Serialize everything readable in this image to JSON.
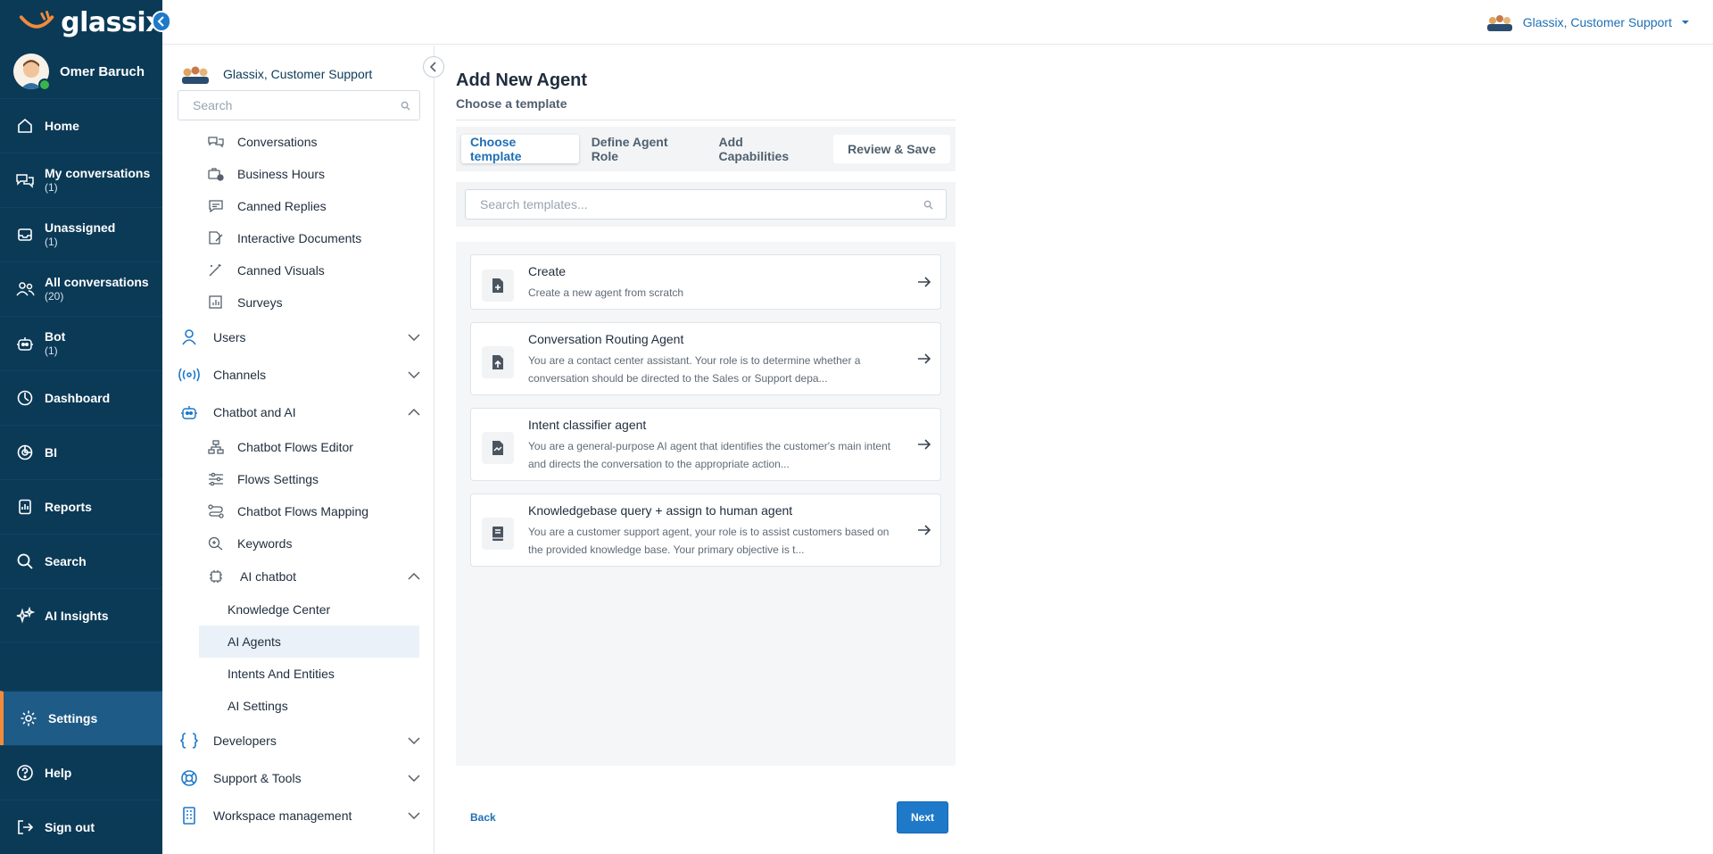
{
  "app": {
    "logo_text": "glassix"
  },
  "user": {
    "name": "Omer Baruch"
  },
  "nav": [
    {
      "label": "Home",
      "count": "",
      "icon": "home-icon"
    },
    {
      "label": "My conversations",
      "count": "(1)",
      "icon": "chat-bubbles-icon"
    },
    {
      "label": "Unassigned",
      "count": "(1)",
      "icon": "inbox-icon"
    },
    {
      "label": "All conversations",
      "count": "(20)",
      "icon": "people-icon"
    },
    {
      "label": "Bot",
      "count": "(1)",
      "icon": "bot-icon"
    },
    {
      "label": "Dashboard",
      "count": "",
      "icon": "dashboard-icon"
    },
    {
      "label": "BI",
      "count": "",
      "icon": "pie-chart-icon"
    },
    {
      "label": "Reports",
      "count": "",
      "icon": "reports-icon"
    },
    {
      "label": "Search",
      "count": "",
      "icon": "search-icon"
    },
    {
      "label": "AI Insights",
      "count": "",
      "icon": "sparkle-icon"
    }
  ],
  "nav_bottom": [
    {
      "label": "Settings",
      "icon": "gear-icon",
      "active": true
    },
    {
      "label": "Help",
      "icon": "help-icon",
      "active": false
    },
    {
      "label": "Sign out",
      "icon": "sign-out-icon",
      "active": false
    }
  ],
  "topbar": {
    "org": "Glassix, Customer Support"
  },
  "tree": {
    "org": "Glassix, Customer Support",
    "search_placeholder": "Search",
    "partial_items": [
      "Conversations",
      "Business Hours",
      "Canned Replies",
      "Interactive Documents",
      "Canned Visuals",
      "Surveys"
    ],
    "sections": [
      "Users",
      "Channels",
      "Chatbot and AI"
    ],
    "chatbot_items": [
      "Chatbot Flows Editor",
      "Flows Settings",
      "Chatbot Flows Mapping",
      "Keywords"
    ],
    "ai_chatbot": "AI chatbot",
    "ai_items": [
      "Knowledge Center",
      "AI Agents",
      "Intents And Entities",
      "AI Settings"
    ],
    "bottom_sections": [
      "Developers",
      "Support & Tools",
      "Workspace management"
    ]
  },
  "main": {
    "title": "Add New Agent",
    "subtitle": "Choose a template",
    "steps": [
      "Choose template",
      "Define Agent Role",
      "Add Capabilities",
      "Review & Save"
    ],
    "active_step": 0,
    "search_placeholder": "Search templates...",
    "templates": [
      {
        "title": "Create",
        "desc": "Create a new agent from scratch",
        "icon": "file-plus-icon"
      },
      {
        "title": "Conversation Routing Agent",
        "desc": "You are a contact center assistant. Your role is to determine whether a conversation should be directed to the Sales or Support depa...",
        "icon": "file-upload-icon"
      },
      {
        "title": "Intent classifier agent",
        "desc": "You are a general-purpose AI agent that identifies the customer's main intent and directs the conversation to the appropriate action...",
        "icon": "file-chart-icon"
      },
      {
        "title": "Knowledgebase query + assign to human agent",
        "desc": "You are a customer support agent, your role is to assist customers based on the provided knowledge base. Your primary objective is t...",
        "icon": "book-icon"
      }
    ],
    "back_label": "Back",
    "next_label": "Next"
  },
  "colors": {
    "nav_bg": "#0b3a57",
    "accent": "#1e79c9",
    "active_border": "#f28b3b"
  }
}
